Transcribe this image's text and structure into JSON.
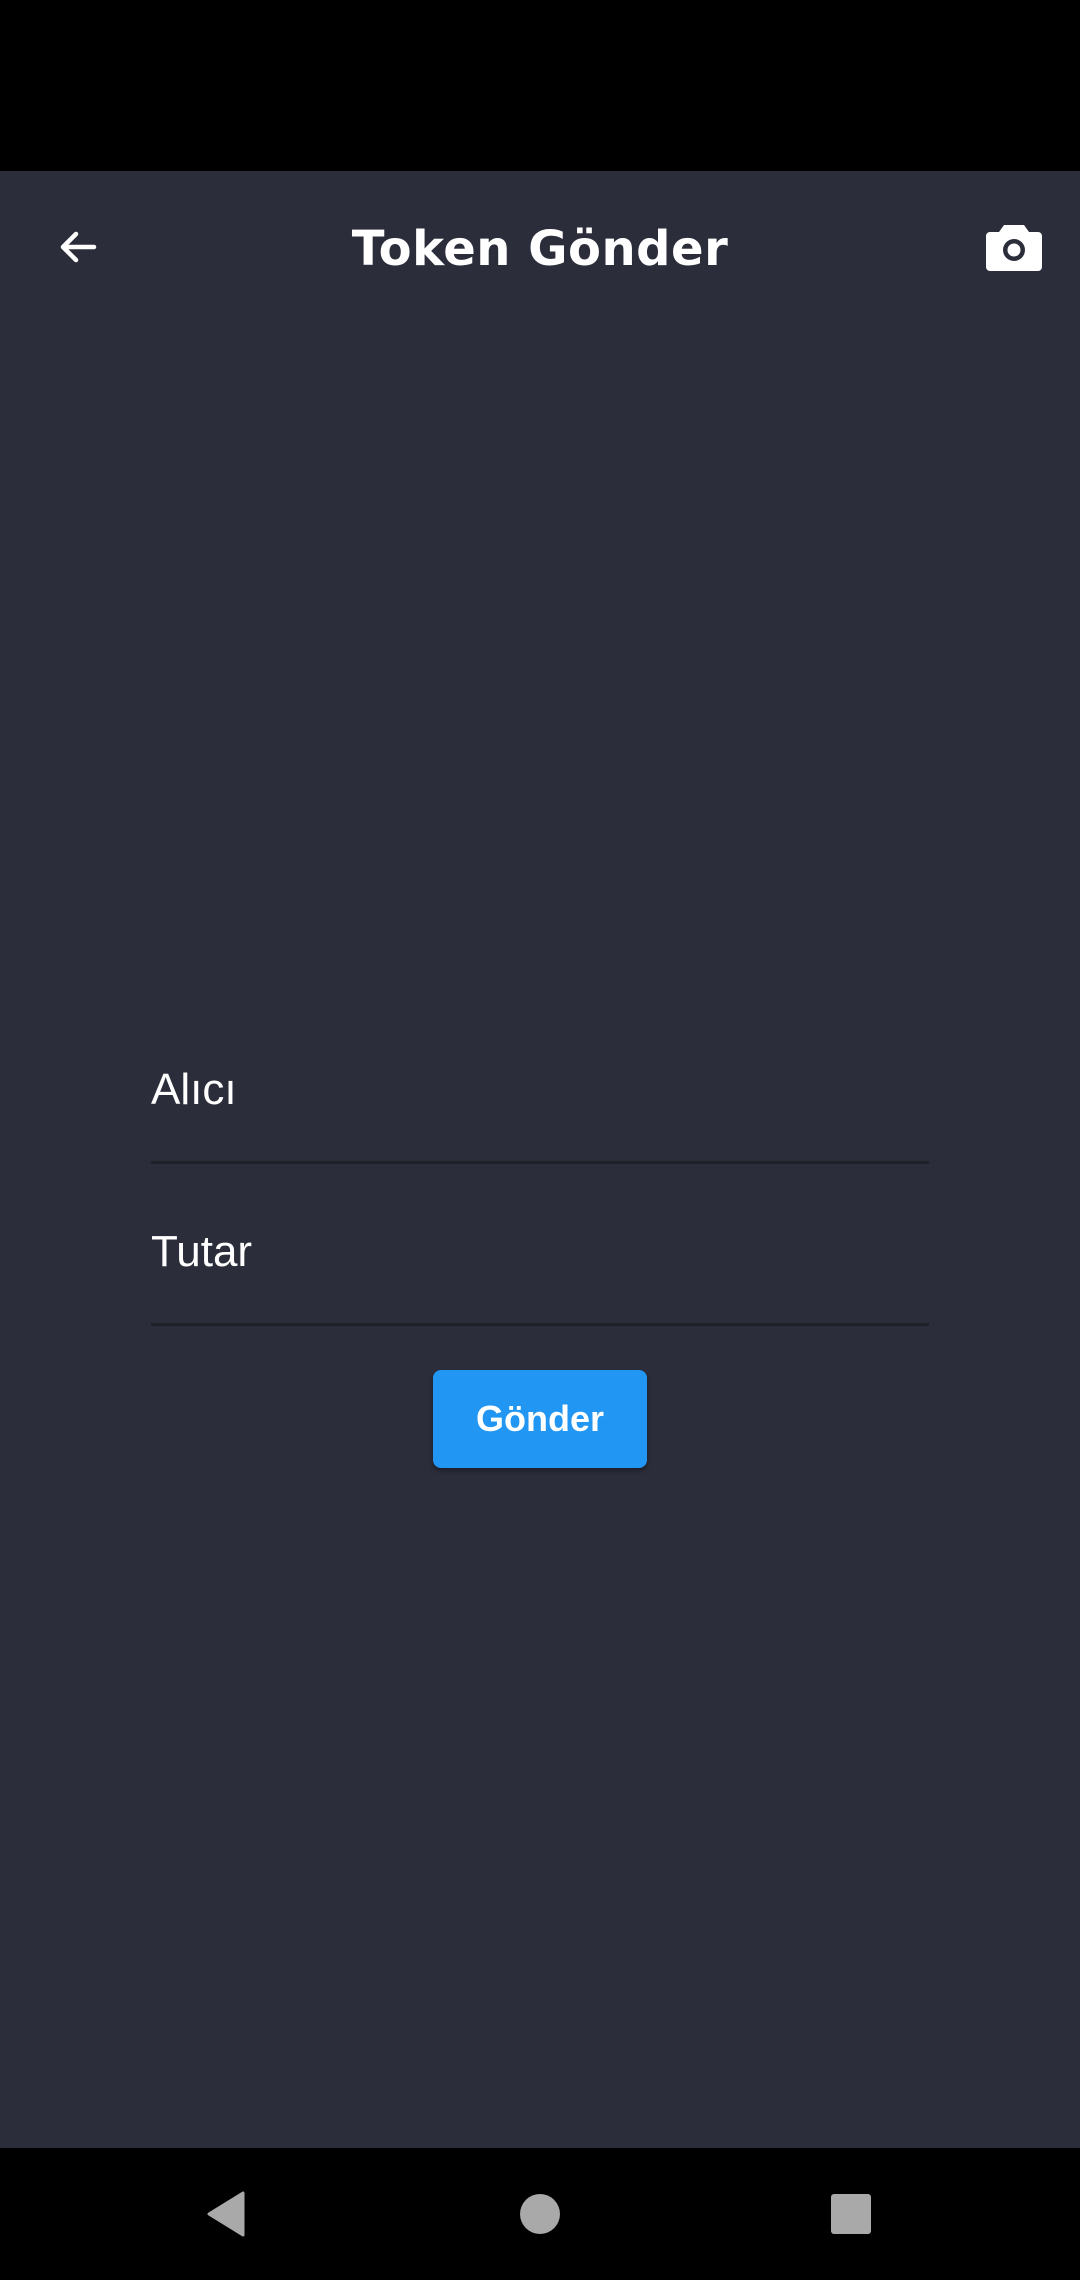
{
  "app_bar": {
    "title": "Token Gönder",
    "back_icon": "arrow-back-icon",
    "camera_icon": "camera-icon"
  },
  "form": {
    "recipient": {
      "label": "Alıcı",
      "value": ""
    },
    "amount": {
      "label": "Tutar",
      "value": ""
    },
    "send_label": "Gönder"
  },
  "nav": {
    "back_icon": "nav-back-triangle-icon",
    "home_icon": "nav-home-circle-icon",
    "recents_icon": "nav-recents-square-icon"
  },
  "colors": {
    "background": "#2c2d3b",
    "accent": "#2196f3",
    "divider": "#1f2029",
    "text": "#ffffff"
  }
}
